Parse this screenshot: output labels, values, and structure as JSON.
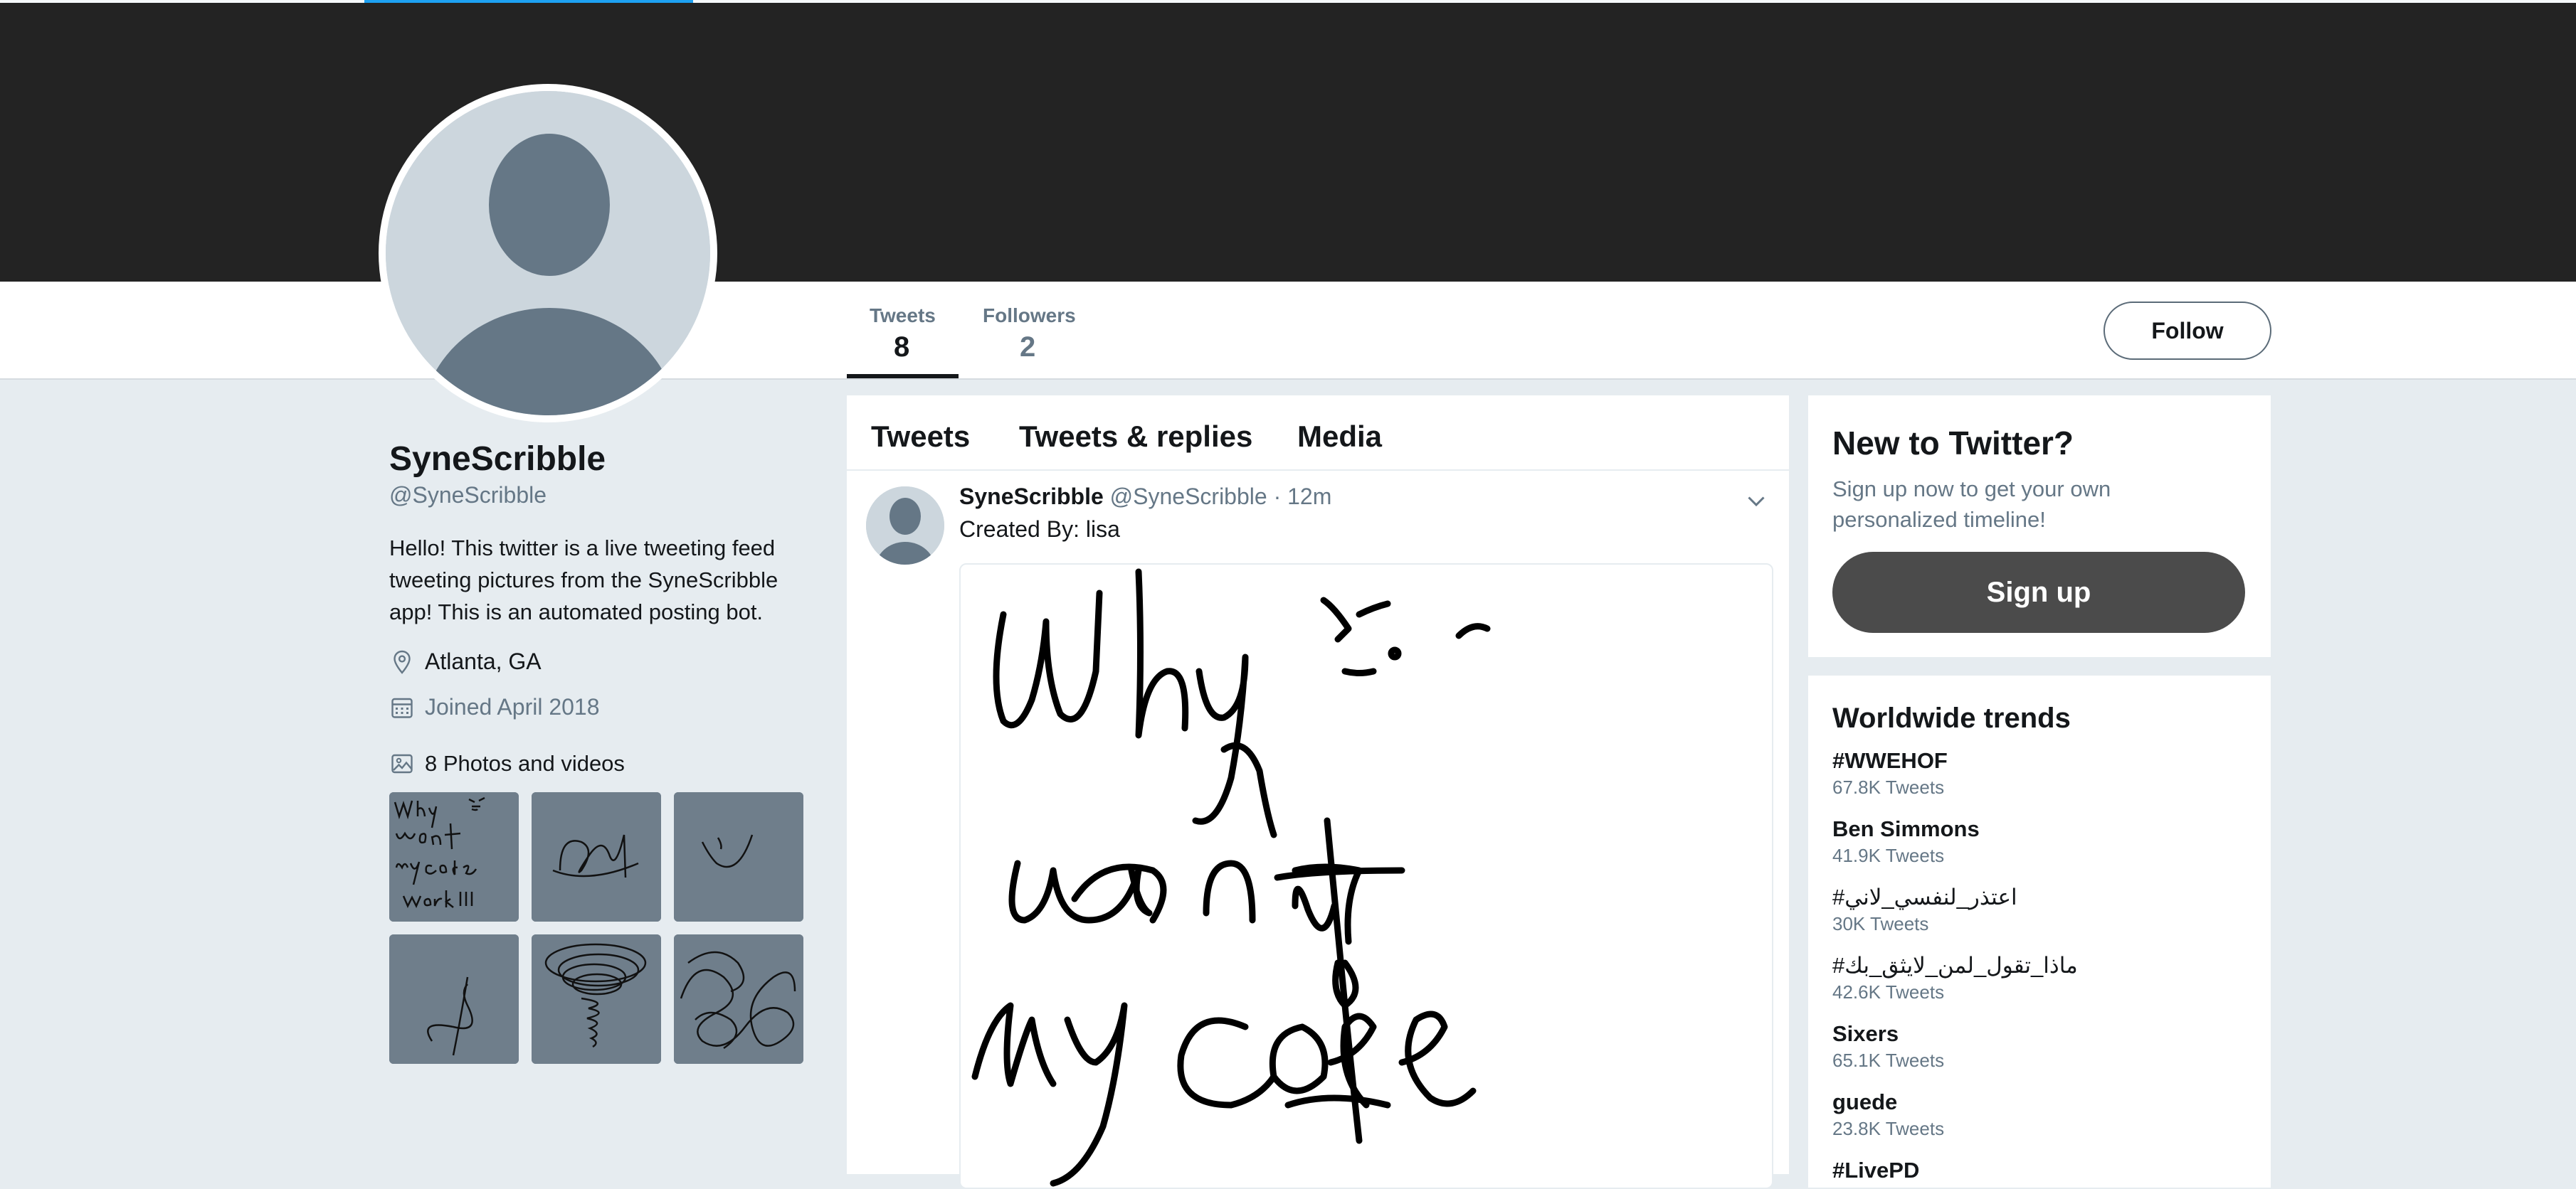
{
  "profile": {
    "name": "SyneScribble",
    "handle": "@SyneScribble",
    "bio": "Hello! This twitter is a live tweeting feed tweeting pictures from the SyneScribble app! This is an automated posting bot.",
    "location": "Atlanta, GA",
    "joined": "Joined April 2018",
    "photos_label": "8 Photos and videos"
  },
  "nav": {
    "stats": [
      {
        "label": "Tweets",
        "value": "8"
      },
      {
        "label": "Followers",
        "value": "2"
      }
    ],
    "follow_label": "Follow"
  },
  "timeline": {
    "tabs": [
      "Tweets",
      "Tweets & replies",
      "Media"
    ],
    "tweet": {
      "author": "SyneScribble",
      "handle": "@SyneScribble",
      "time": "· 12m",
      "text": "Created By: lisa"
    }
  },
  "signup": {
    "title": "New to Twitter?",
    "subtitle": "Sign up now to get your own personalized timeline!",
    "button": "Sign up"
  },
  "trends": {
    "title": "Worldwide trends",
    "items": [
      {
        "name": "#WWEHOF",
        "count": "67.8K Tweets"
      },
      {
        "name": "Ben Simmons",
        "count": "41.9K Tweets"
      },
      {
        "name": "#اعتذر_لنفسي_لاني",
        "count": "30K Tweets"
      },
      {
        "name": "#ماذا_تقول_لمن_لايثق_بك",
        "count": "42.6K Tweets"
      },
      {
        "name": "Sixers",
        "count": "65.1K Tweets"
      },
      {
        "name": "guede",
        "count": "23.8K Tweets"
      },
      {
        "name": "#LivePD",
        "count": ""
      }
    ]
  },
  "colors": {
    "banner": "#232323",
    "page_bg": "#e6ecf0",
    "secondary_text": "#657786",
    "signup_button": "#4b4b4b"
  },
  "icons": {
    "location": "location-pin-icon",
    "joined": "calendar-icon",
    "photos": "image-icon",
    "caret": "chevron-down-icon"
  }
}
